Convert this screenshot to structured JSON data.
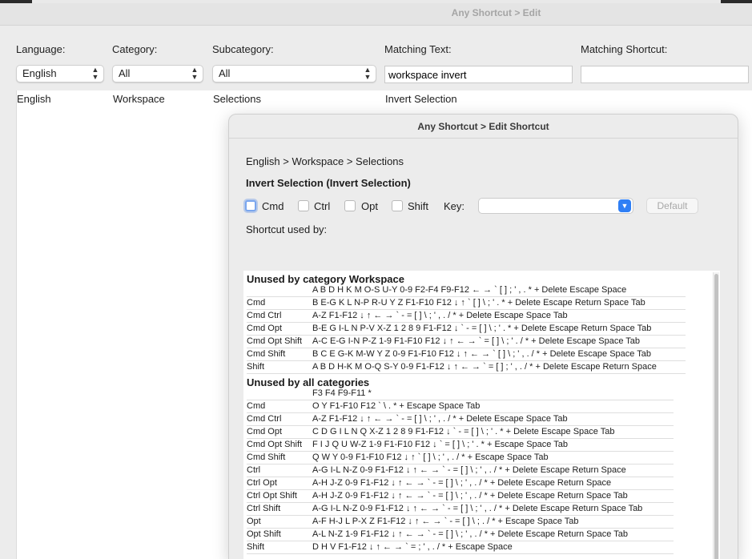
{
  "window": {
    "title": "Any Shortcut > Edit"
  },
  "filters": {
    "language_label": "Language:",
    "language_value": "English",
    "category_label": "Category:",
    "category_value": "All",
    "subcategory_label": "Subcategory:",
    "subcategory_value": "All",
    "matching_text_label": "Matching Text:",
    "matching_text_value": "workspace invert",
    "matching_shortcut_label": "Matching Shortcut:",
    "matching_shortcut_value": ""
  },
  "results": {
    "row": {
      "language": "English",
      "category": "Workspace",
      "subcategory": "Selections",
      "command": "Invert Selection"
    }
  },
  "sheet": {
    "title": "Any Shortcut > Edit Shortcut",
    "path": "English > Workspace > Selections",
    "command": "Invert Selection (Invert Selection)",
    "cmd_label": "Cmd",
    "ctrl_label": "Ctrl",
    "opt_label": "Opt",
    "shift_label": "Shift",
    "key_label": "Key:",
    "key_value": "",
    "default_label": "Default",
    "used_by_label": "Shortcut used by:"
  },
  "report": {
    "sections": [
      {
        "title": "Unused by category Workspace",
        "rows": [
          {
            "mod": "",
            "keys": "A B D H K M O-S U-Y 0-9 F2-F4 F9-F12 ← → ` [ ] ; ' , . * + Delete Escape Space"
          },
          {
            "mod": "Cmd",
            "keys": "B E-G K L N-P R-U Y Z F1-F10 F12 ↓ ↑ ` [ ] \\ ; ' . * + Delete Escape Return Space Tab"
          },
          {
            "mod": "Cmd Ctrl",
            "keys": "A-Z F1-F12 ↓ ↑ ← → ` - = [ ] \\ ; ' , . / * + Delete Escape Space Tab"
          },
          {
            "mod": "Cmd Opt",
            "keys": "B-E G I-L N P-V X-Z 1 2 8 9 F1-F12 ↓ ` - = [ ] \\ ; ' . * + Delete Escape Return Space Tab"
          },
          {
            "mod": "Cmd Opt Shift",
            "keys": "A-C E-G I-N P-Z 1-9 F1-F10 F12 ↓ ↑ ← → ` = [ ] \\ ; ' . / * + Delete Escape Space Tab"
          },
          {
            "mod": "Cmd Shift",
            "keys": "B C E G-K M-W Y Z 0-9 F1-F10 F12 ↓ ↑ ← → ` [ ] \\ ; ' , . / * + Delete Escape Space Tab"
          },
          {
            "mod": "Shift",
            "keys": "A B D H-K M O-Q S-Y 0-9 F1-F12 ↓ ↑ ← → ` = [ ] ; ' , . / * + Delete Escape Return Space"
          }
        ]
      },
      {
        "title": "Unused by all categories",
        "rows": [
          {
            "mod": "",
            "keys": "F3 F4 F9-F11 *"
          },
          {
            "mod": "Cmd",
            "keys": "O Y F1-F10 F12 ` \\ . * + Escape Space Tab"
          },
          {
            "mod": "Cmd Ctrl",
            "keys": "A-Z F1-F12 ↓ ↑ ← → ` - = [ ] \\ ; ' , . / * + Delete Escape Space Tab"
          },
          {
            "mod": "Cmd Opt",
            "keys": "C D G I L N Q X-Z 1 2 8 9 F1-F12 ↓ ` - = [ ] \\ ; ' . * + Delete Escape Space Tab"
          },
          {
            "mod": "Cmd Opt Shift",
            "keys": "F I J Q U W-Z 1-9 F1-F10 F12 ↓ ` = [ ] \\ ; ' . * + Escape Space Tab"
          },
          {
            "mod": "Cmd Shift",
            "keys": "Q W Y 0-9 F1-F10 F12 ↓ ↑ ` [ ] \\ ; ' , . / * + Escape Space Tab"
          },
          {
            "mod": "Ctrl",
            "keys": "A-G I-L N-Z 0-9 F1-F12 ↓ ↑ ← → ` - = [ ] \\ ; ' , . / * + Delete Escape Return Space"
          },
          {
            "mod": "Ctrl Opt",
            "keys": "A-H J-Z 0-9 F1-F12 ↓ ↑ ← → ` - = [ ] \\ ; ' , . / * + Delete Escape Return Space"
          },
          {
            "mod": "Ctrl Opt Shift",
            "keys": "A-H J-Z 0-9 F1-F12 ↓ ↑ ← → ` - = [ ] \\ ; ' , . / * + Delete Escape Return Space Tab"
          },
          {
            "mod": "Ctrl Shift",
            "keys": "A-G I-L N-Z 0-9 F1-F12 ↓ ↑ ← → ` - = [ ] \\ ; ' , . / * + Delete Escape Return Space Tab"
          },
          {
            "mod": "Opt",
            "keys": "A-F H-J L P-X Z F1-F12 ↓ ↑ ← → ` - = [ ] \\ ; . / * + Escape Space Tab"
          },
          {
            "mod": "Opt Shift",
            "keys": "A-L N-Z 1-9 F1-F12 ↓ ↑ ← → ` - = [ ] \\ ; ' , . / * + Delete Escape Return Space Tab"
          },
          {
            "mod": "Shift",
            "keys": "D H V F1-F12 ↓ ↑ ← → ` = ; ' , . / * + Escape Space"
          }
        ]
      }
    ]
  }
}
